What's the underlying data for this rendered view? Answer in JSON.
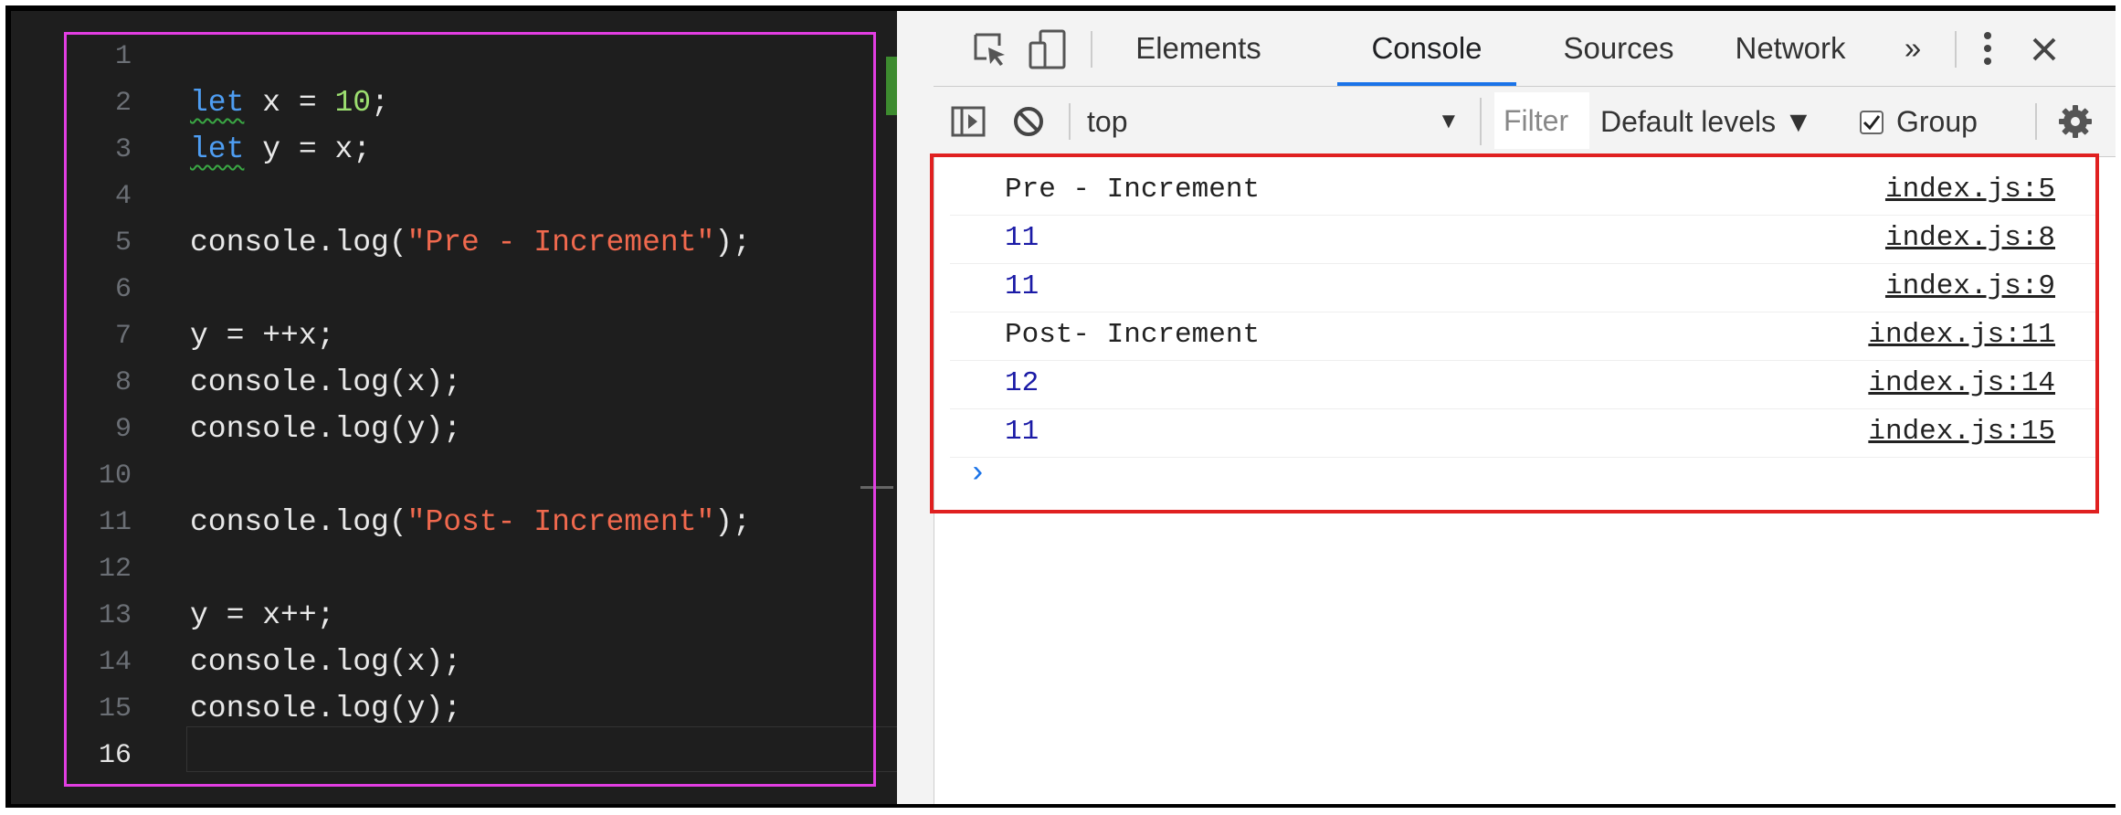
{
  "editor": {
    "lines": [
      {
        "num": "1",
        "parts": []
      },
      {
        "num": "2",
        "parts": [
          {
            "t": "let",
            "k": "kw"
          },
          {
            "t": " x = ",
            "k": "plain"
          },
          {
            "t": "10",
            "k": "num"
          },
          {
            "t": ";",
            "k": "plain"
          }
        ]
      },
      {
        "num": "3",
        "parts": [
          {
            "t": "let",
            "k": "kw"
          },
          {
            "t": " y = x;",
            "k": "plain"
          }
        ]
      },
      {
        "num": "4",
        "parts": []
      },
      {
        "num": "5",
        "parts": [
          {
            "t": "console.log(",
            "k": "plain"
          },
          {
            "t": "\"Pre - Increment\"",
            "k": "str"
          },
          {
            "t": ");",
            "k": "plain"
          }
        ]
      },
      {
        "num": "6",
        "parts": []
      },
      {
        "num": "7",
        "parts": [
          {
            "t": "y = ++x;",
            "k": "plain"
          }
        ]
      },
      {
        "num": "8",
        "parts": [
          {
            "t": "console.log(x);",
            "k": "plain"
          }
        ]
      },
      {
        "num": "9",
        "parts": [
          {
            "t": "console.log(y);",
            "k": "plain"
          }
        ]
      },
      {
        "num": "10",
        "parts": []
      },
      {
        "num": "11",
        "parts": [
          {
            "t": "console.log(",
            "k": "plain"
          },
          {
            "t": "\"Post- Increment\"",
            "k": "str"
          },
          {
            "t": ");",
            "k": "plain"
          }
        ]
      },
      {
        "num": "12",
        "parts": []
      },
      {
        "num": "13",
        "parts": [
          {
            "t": "y = x++;",
            "k": "plain"
          }
        ]
      },
      {
        "num": "14",
        "parts": [
          {
            "t": "console.log(x);",
            "k": "plain"
          }
        ]
      },
      {
        "num": "15",
        "parts": [
          {
            "t": "console.log(y);",
            "k": "plain"
          }
        ]
      },
      {
        "num": "16",
        "parts": [],
        "active": true
      }
    ]
  },
  "devtools": {
    "tabs": {
      "elements": "Elements",
      "console": "Console",
      "sources": "Sources",
      "network": "Network",
      "more": "»"
    },
    "toolbar": {
      "context": "top",
      "filter": "Filter",
      "levels": "Default levels ▼",
      "group": "Group",
      "group_checked": true
    },
    "console": {
      "messages": [
        {
          "text": "Pre - Increment",
          "kind": "string",
          "source": "index.js:5"
        },
        {
          "text": "11",
          "kind": "number",
          "source": "index.js:8"
        },
        {
          "text": "11",
          "kind": "number",
          "source": "index.js:9"
        },
        {
          "text": "Post- Increment",
          "kind": "string",
          "source": "index.js:11"
        },
        {
          "text": "12",
          "kind": "number",
          "source": "index.js:14"
        },
        {
          "text": "11",
          "kind": "number",
          "source": "index.js:15"
        }
      ],
      "prompt": "›"
    }
  },
  "colors": {
    "editor_highlight": "#e23ee2",
    "console_highlight": "#e02020",
    "keyword": "#4e9df2",
    "number": "#9cde70",
    "string": "#f0694e",
    "console_number": "#1a1aa6"
  }
}
